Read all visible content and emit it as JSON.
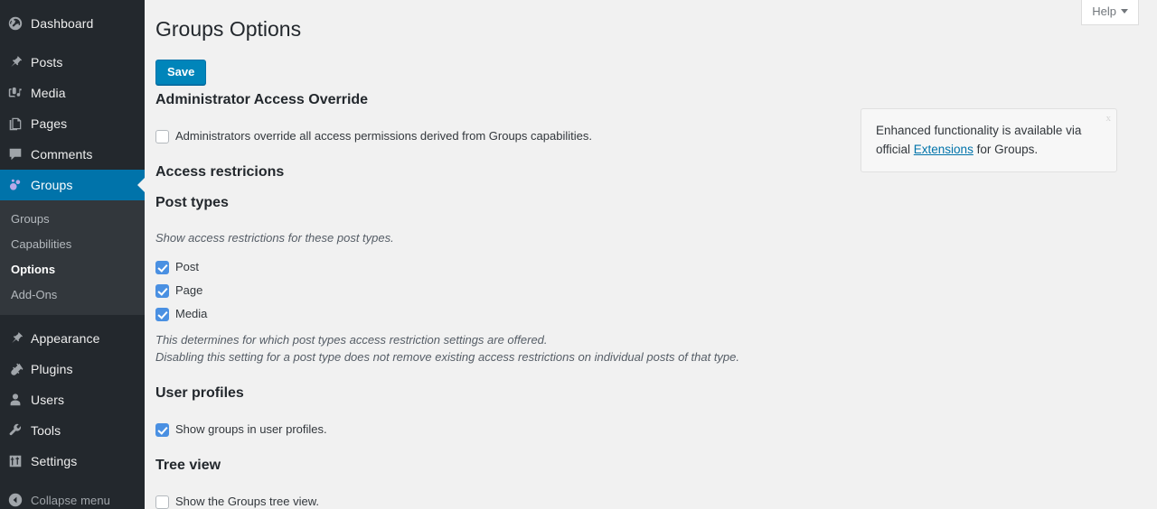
{
  "sidebar": {
    "items": [
      {
        "label": "Dashboard",
        "icon": "dashboard-icon",
        "key": "dashboard"
      },
      {
        "label": "Posts",
        "icon": "pin-icon",
        "key": "posts"
      },
      {
        "label": "Media",
        "icon": "media-icon",
        "key": "media"
      },
      {
        "label": "Pages",
        "icon": "pages-icon",
        "key": "pages"
      },
      {
        "label": "Comments",
        "icon": "comment-icon",
        "key": "comments"
      },
      {
        "label": "Groups",
        "icon": "groups-icon",
        "key": "groups"
      },
      {
        "label": "Appearance",
        "icon": "brush-icon",
        "key": "appearance"
      },
      {
        "label": "Plugins",
        "icon": "plug-icon",
        "key": "plugins"
      },
      {
        "label": "Users",
        "icon": "user-icon",
        "key": "users"
      },
      {
        "label": "Tools",
        "icon": "wrench-icon",
        "key": "tools"
      },
      {
        "label": "Settings",
        "icon": "sliders-icon",
        "key": "settings"
      }
    ],
    "submenu": [
      {
        "label": "Groups",
        "active": false
      },
      {
        "label": "Capabilities",
        "active": false
      },
      {
        "label": "Options",
        "active": true
      },
      {
        "label": "Add-Ons",
        "active": false
      }
    ],
    "collapse": {
      "label": "Collapse menu",
      "icon": "collapse-icon"
    },
    "active_item": "Groups",
    "accent_color": "#0073aa",
    "background_color": "#23282d",
    "submenu_background_color": "#32373c"
  },
  "header": {
    "page_title": "Groups Options",
    "help_tab_label": "Help",
    "save_label": "Save",
    "save_color": "#0085ba"
  },
  "sections": {
    "admin_override": {
      "heading": "Administrator Access Override",
      "checkbox_label": "Administrators override all access permissions derived from Groups capabilities.",
      "checked": false
    },
    "access_restrictions": {
      "heading": "Access restricions"
    },
    "post_types": {
      "heading": "Post types",
      "description": "Show access restrictions for these post types.",
      "options": [
        {
          "label": "Post",
          "checked": true
        },
        {
          "label": "Page",
          "checked": true
        },
        {
          "label": "Media",
          "checked": true
        }
      ],
      "note_line_1": "This determines for which post types access restriction settings are offered.",
      "note_line_2": "Disabling this setting for a post type does not remove existing access restrictions on individual posts of that type."
    },
    "user_profiles": {
      "heading": "User profiles",
      "checkbox_label": "Show groups in user profiles.",
      "checked": true
    },
    "tree_view": {
      "heading": "Tree view",
      "checkbox_label": "Show the Groups tree view.",
      "checked": false
    }
  },
  "notice": {
    "text_before": "Enhanced functionality is available via official ",
    "link_label": "Extensions",
    "text_after": " for Groups.",
    "dismiss_label": "x"
  }
}
